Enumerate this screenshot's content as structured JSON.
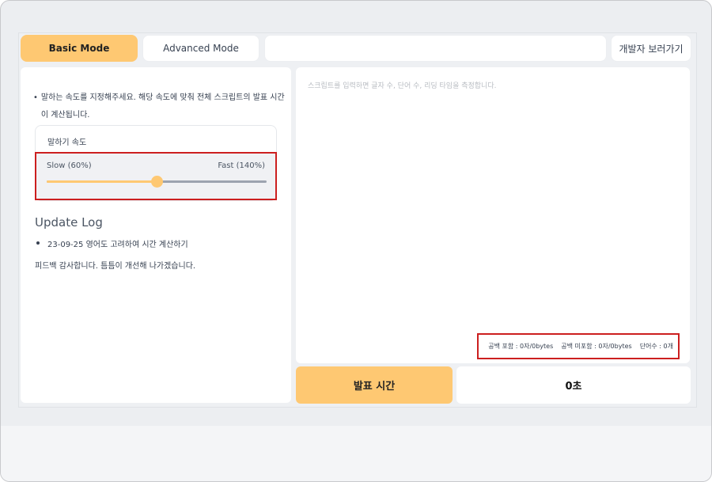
{
  "tabs": {
    "basic": "Basic Mode",
    "advanced": "Advanced Mode",
    "developer": "개발자 보러가기"
  },
  "notice": {
    "bullet": "•",
    "text": "말하는 속도를 지정해주세요. 해당 속도에 맞춰 전체 스크립트의 발표 시간이 계산됩니다."
  },
  "speed": {
    "title": "말하기 속도",
    "slow_label": "Slow (60%)",
    "fast_label": "Fast (140%)",
    "value_fraction": 0.5
  },
  "update_log": {
    "title": "Update Log",
    "items": [
      "23-09-25 영어도 고려하여 시간 계산하기"
    ],
    "feedback": "피드백 감사합니다. 틈틈이 개선해 나가겠습니다."
  },
  "script": {
    "placeholder": "스크립트를 입력하면 글자 수, 단어 수, 리딩 타임을 측정합니다."
  },
  "stats": {
    "with_spaces": "공백 포함 : 0자/0bytes",
    "without_spaces": "공백 미포함 : 0자/0bytes",
    "words": "단어수 : 0개"
  },
  "presentation": {
    "button_label": "발표 시간",
    "result": "0초"
  },
  "colors": {
    "accent": "#fec872",
    "highlight_box": "#cc1f1f"
  }
}
